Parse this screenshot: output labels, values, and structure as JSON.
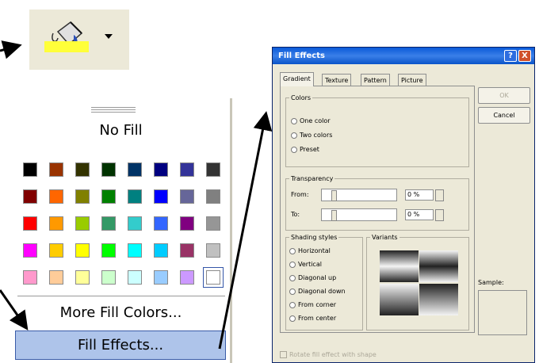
{
  "toolbar": {
    "fill_color_icon": "paint-bucket-icon",
    "dropdown_icon": "chevron-down-icon",
    "fill_color_bar": "#ffff3a"
  },
  "palette": {
    "no_fill_label": "No Fill",
    "colors": [
      [
        "#000000",
        "#993300",
        "#333300",
        "#003300",
        "#003366",
        "#000080",
        "#333399",
        "#333333"
      ],
      [
        "#800000",
        "#ff6600",
        "#808000",
        "#008000",
        "#008080",
        "#0000ff",
        "#666699",
        "#808080"
      ],
      [
        "#ff0000",
        "#ff9900",
        "#99cc00",
        "#339966",
        "#33cccc",
        "#3366ff",
        "#800080",
        "#969696"
      ],
      [
        "#ff00ff",
        "#ffcc00",
        "#ffff00",
        "#00ff00",
        "#00ffff",
        "#00ccff",
        "#993366",
        "#c0c0c0"
      ],
      [
        "#ff99cc",
        "#ffcc99",
        "#ffff99",
        "#ccffcc",
        "#ccffff",
        "#99ccff",
        "#cc99ff",
        "#ffffff"
      ]
    ],
    "more_colors_label": "More Fill Colors...",
    "fill_effects_label": "Fill Effects..."
  },
  "dialog": {
    "title": "Fill Effects",
    "help_symbol": "?",
    "close_symbol": "X",
    "tabs": [
      "Gradient",
      "Texture",
      "Pattern",
      "Picture"
    ],
    "colors_group": "Colors",
    "color_options": [
      "One color",
      "Two colors",
      "Preset"
    ],
    "transparency_group": "Transparency",
    "from_label": "From:",
    "to_label": "To:",
    "from_value": "0 %",
    "to_value": "0 %",
    "shading_group": "Shading styles",
    "shading_options": [
      "Horizontal",
      "Vertical",
      "Diagonal up",
      "Diagonal down",
      "From corner",
      "From center"
    ],
    "variants_label": "Variants",
    "ok_label": "OK",
    "cancel_label": "Cancel",
    "sample_label": "Sample:",
    "rotate_label": "Rotate fill effect with shape"
  }
}
